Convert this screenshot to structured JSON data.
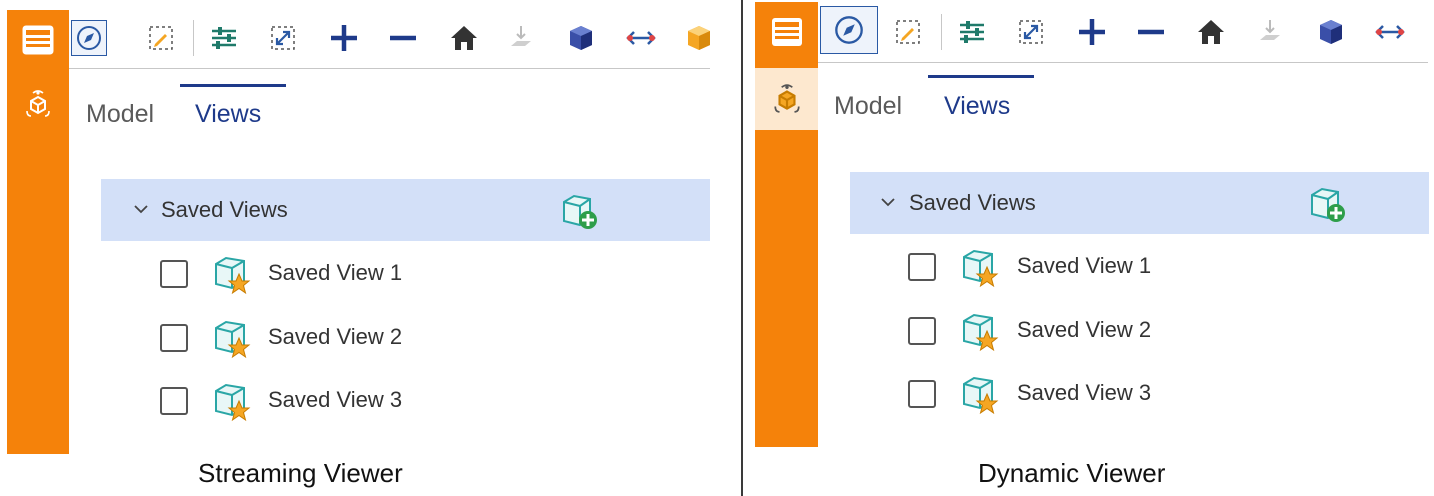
{
  "panels": [
    {
      "tabs": [
        {
          "label": "Model"
        },
        {
          "label": "Views"
        }
      ],
      "group": {
        "label": "Saved Views"
      },
      "views": [
        {
          "label": "Saved View 1"
        },
        {
          "label": "Saved View 2"
        },
        {
          "label": "Saved View 3"
        }
      ],
      "caption": "Streaming Viewer"
    },
    {
      "tabs": [
        {
          "label": "Model"
        },
        {
          "label": "Views"
        }
      ],
      "group": {
        "label": "Saved Views"
      },
      "views": [
        {
          "label": "Saved View 1"
        },
        {
          "label": "Saved View 2"
        },
        {
          "label": "Saved View 3"
        }
      ],
      "caption": "Dynamic Viewer"
    }
  ],
  "colors": {
    "sidebar": "#f5820a",
    "accent": "#1e3a8a",
    "group_header_bg": "#d3e0f8",
    "toolbar_blue": "#2a59a4"
  },
  "toolbar_icons": [
    "navigate-icon",
    "markup-icon",
    "settings-sliders-icon",
    "fit-view-icon",
    "zoom-in-icon",
    "zoom-out-icon",
    "home-icon",
    "section-icon",
    "cube-icon",
    "measure-icon",
    "part-icon"
  ]
}
